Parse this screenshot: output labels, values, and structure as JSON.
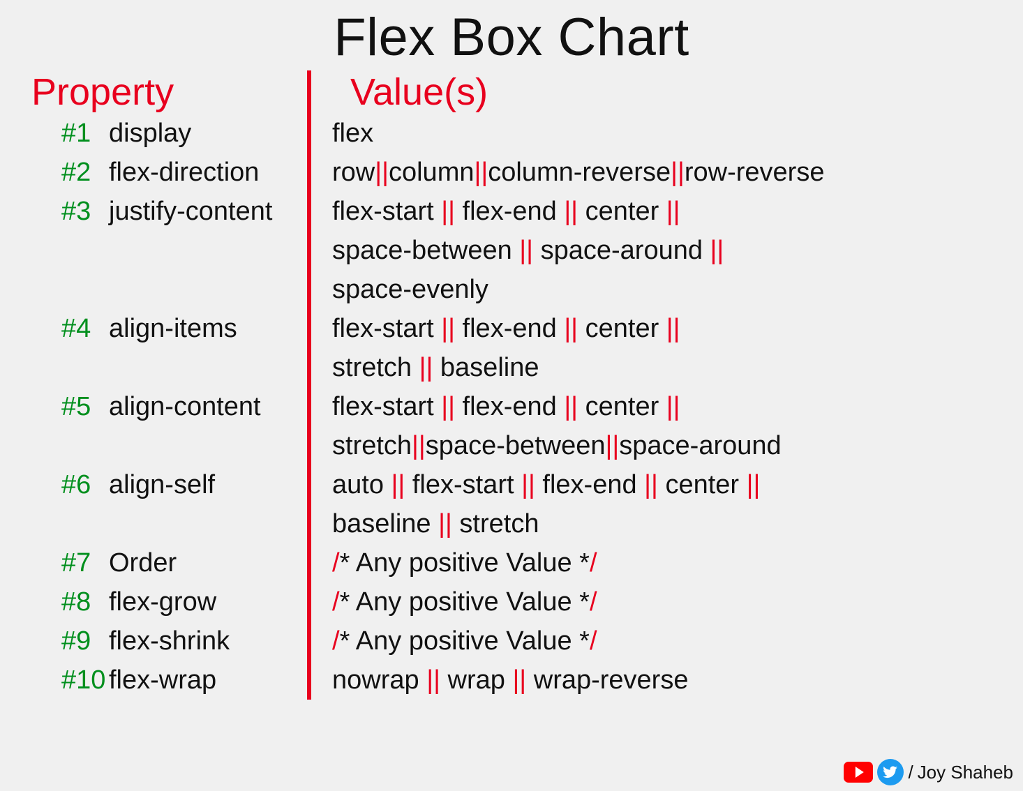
{
  "title": "Flex Box Chart",
  "header": {
    "property": "Property",
    "values": "Value(s)"
  },
  "rows": [
    {
      "idx": "#1",
      "prop": "display"
    },
    {
      "idx": "#2",
      "prop": "flex-direction"
    },
    {
      "idx": "#3",
      "prop": "justify-content"
    },
    {
      "idx": "#4",
      "prop": "align-items"
    },
    {
      "idx": "#5",
      "prop": "align-content"
    },
    {
      "idx": "#6",
      "prop": "align-self"
    },
    {
      "idx": "#7",
      "prop": "Order"
    },
    {
      "idx": "#8",
      "prop": "flex-grow"
    },
    {
      "idx": "#9",
      "prop": "flex-shrink"
    },
    {
      "idx": "#10",
      "prop": "flex-wrap"
    }
  ],
  "credit": {
    "slash": "/ ",
    "name": "Joy Shaheb"
  },
  "chart_data": {
    "type": "table",
    "title": "Flex Box Chart",
    "columns": [
      "Property",
      "Value(s)"
    ],
    "rows": [
      {
        "index": 1,
        "property": "display",
        "values": [
          "flex"
        ]
      },
      {
        "index": 2,
        "property": "flex-direction",
        "values": [
          "row",
          "column",
          "column-reverse",
          "row-reverse"
        ]
      },
      {
        "index": 3,
        "property": "justify-content",
        "values": [
          "flex-start",
          "flex-end",
          "center",
          "space-between",
          "space-around",
          "space-evenly"
        ]
      },
      {
        "index": 4,
        "property": "align-items",
        "values": [
          "flex-start",
          "flex-end",
          "center",
          "stretch",
          "baseline"
        ]
      },
      {
        "index": 5,
        "property": "align-content",
        "values": [
          "flex-start",
          "flex-end",
          "center",
          "stretch",
          "space-between",
          "space-around"
        ]
      },
      {
        "index": 6,
        "property": "align-self",
        "values": [
          "auto",
          "flex-start",
          "flex-end",
          "center",
          "baseline",
          "stretch"
        ]
      },
      {
        "index": 7,
        "property": "Order",
        "values": [
          "/* Any positive Value */"
        ]
      },
      {
        "index": 8,
        "property": "flex-grow",
        "values": [
          "/* Any positive Value */"
        ]
      },
      {
        "index": 9,
        "property": "flex-shrink",
        "values": [
          "/* Any positive Value */"
        ]
      },
      {
        "index": 10,
        "property": "flex-wrap",
        "values": [
          "nowrap",
          "wrap",
          "wrap-reverse"
        ]
      }
    ]
  }
}
